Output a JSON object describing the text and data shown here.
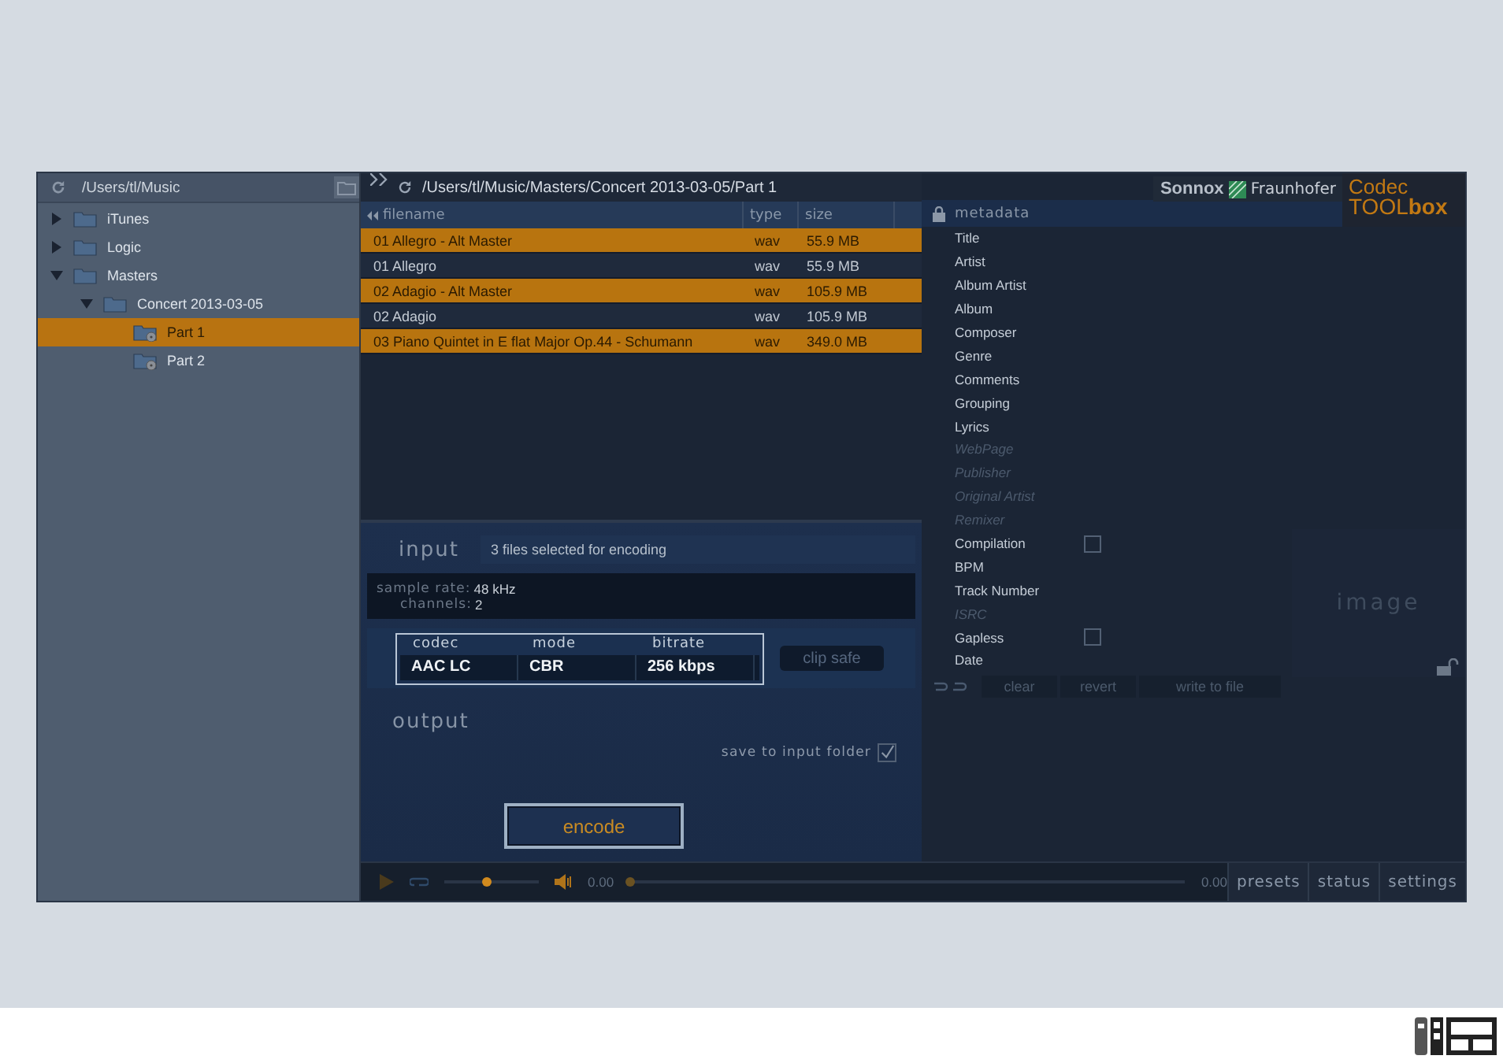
{
  "browser": {
    "path": "/Users/tl/Music",
    "tree": [
      {
        "label": "iTunes",
        "expanded": false,
        "selected": false
      },
      {
        "label": "Logic",
        "expanded": false,
        "selected": false
      },
      {
        "label": "Masters",
        "expanded": true,
        "selected": false,
        "children": [
          {
            "label": "Concert 2013-03-05",
            "expanded": true,
            "selected": false,
            "children": [
              {
                "label": "Part 1",
                "kind": "disc",
                "selected": true
              },
              {
                "label": "Part 2",
                "kind": "disc",
                "selected": false
              }
            ]
          }
        ]
      }
    ]
  },
  "files": {
    "path": "/Users/tl/Music/Masters/Concert 2013-03-05/Part 1",
    "columns": [
      "filename",
      "type",
      "size"
    ],
    "rows": [
      {
        "filename": "01 Allegro - Alt Master",
        "type": "wav",
        "size": "55.9 MB",
        "selected": true
      },
      {
        "filename": "01 Allegro",
        "type": "wav",
        "size": "55.9 MB",
        "selected": false
      },
      {
        "filename": "02 Adagio - Alt Master",
        "type": "wav",
        "size": "105.9 MB",
        "selected": true
      },
      {
        "filename": "02 Adagio",
        "type": "wav",
        "size": "105.9 MB",
        "selected": false
      },
      {
        "filename": "03 Piano Quintet in E flat Major Op.44 - Schumann",
        "type": "wav",
        "size": "349.0 MB",
        "selected": true
      }
    ]
  },
  "input": {
    "heading": "input",
    "summary": "3 files selected for encoding",
    "sample_rate_label": "sample rate:",
    "sample_rate": "48 kHz",
    "channels_label": "channels:",
    "channels": "2"
  },
  "codec": {
    "headers": [
      "codec",
      "mode",
      "bitrate"
    ],
    "values": [
      "AAC LC",
      "CBR",
      "256 kbps"
    ],
    "clip_safe": {
      "label": "clip safe",
      "on": false
    }
  },
  "output": {
    "heading": "output",
    "save_label": "save to input folder",
    "save_checked": true,
    "encode": "encode"
  },
  "transport": {
    "volume": {
      "level": 0.45
    },
    "time": "0.00",
    "position": {
      "level": 0.0
    },
    "end_time": "0.00"
  },
  "branding": {
    "sonnox": "Sonnox",
    "fraunhofer": "Fraunhofer",
    "product_1": "Codec",
    "product_2a": "TOOL",
    "product_2b": "box"
  },
  "metadata": {
    "heading": "metadata",
    "fields": [
      {
        "label": "Title",
        "kind": "text",
        "disabled": false
      },
      {
        "label": "Artist",
        "kind": "text",
        "disabled": false
      },
      {
        "label": "Album Artist",
        "kind": "text",
        "disabled": false
      },
      {
        "label": "Album",
        "kind": "text",
        "disabled": false
      },
      {
        "label": "Composer",
        "kind": "text",
        "disabled": false
      },
      {
        "label": "Genre",
        "kind": "text",
        "disabled": false
      },
      {
        "label": "Comments",
        "kind": "text",
        "disabled": false
      },
      {
        "label": "Grouping",
        "kind": "text",
        "disabled": false
      },
      {
        "label": "Lyrics",
        "kind": "text",
        "disabled": false
      },
      {
        "label": "WebPage",
        "kind": "text",
        "disabled": true
      },
      {
        "label": "Publisher",
        "kind": "text",
        "disabled": true
      },
      {
        "label": "Original Artist",
        "kind": "text",
        "disabled": true
      },
      {
        "label": "Remixer",
        "kind": "text",
        "disabled": true
      },
      {
        "label": "Compilation",
        "kind": "checkbox",
        "disabled": false,
        "checked": false
      },
      {
        "label": "BPM",
        "kind": "text",
        "disabled": false
      },
      {
        "label": "Track Number",
        "kind": "text",
        "disabled": false
      },
      {
        "label": "ISRC",
        "kind": "text",
        "disabled": true
      },
      {
        "label": "Gapless",
        "kind": "checkbox",
        "disabled": false,
        "checked": false
      },
      {
        "label": "Date",
        "kind": "text",
        "disabled": false
      }
    ],
    "image_label": "image",
    "buttons": [
      "clear",
      "revert",
      "write to file"
    ]
  },
  "tabs": [
    {
      "label": "presets",
      "selected": false
    },
    {
      "label": "status",
      "selected": false
    },
    {
      "label": "settings",
      "selected": false
    }
  ]
}
